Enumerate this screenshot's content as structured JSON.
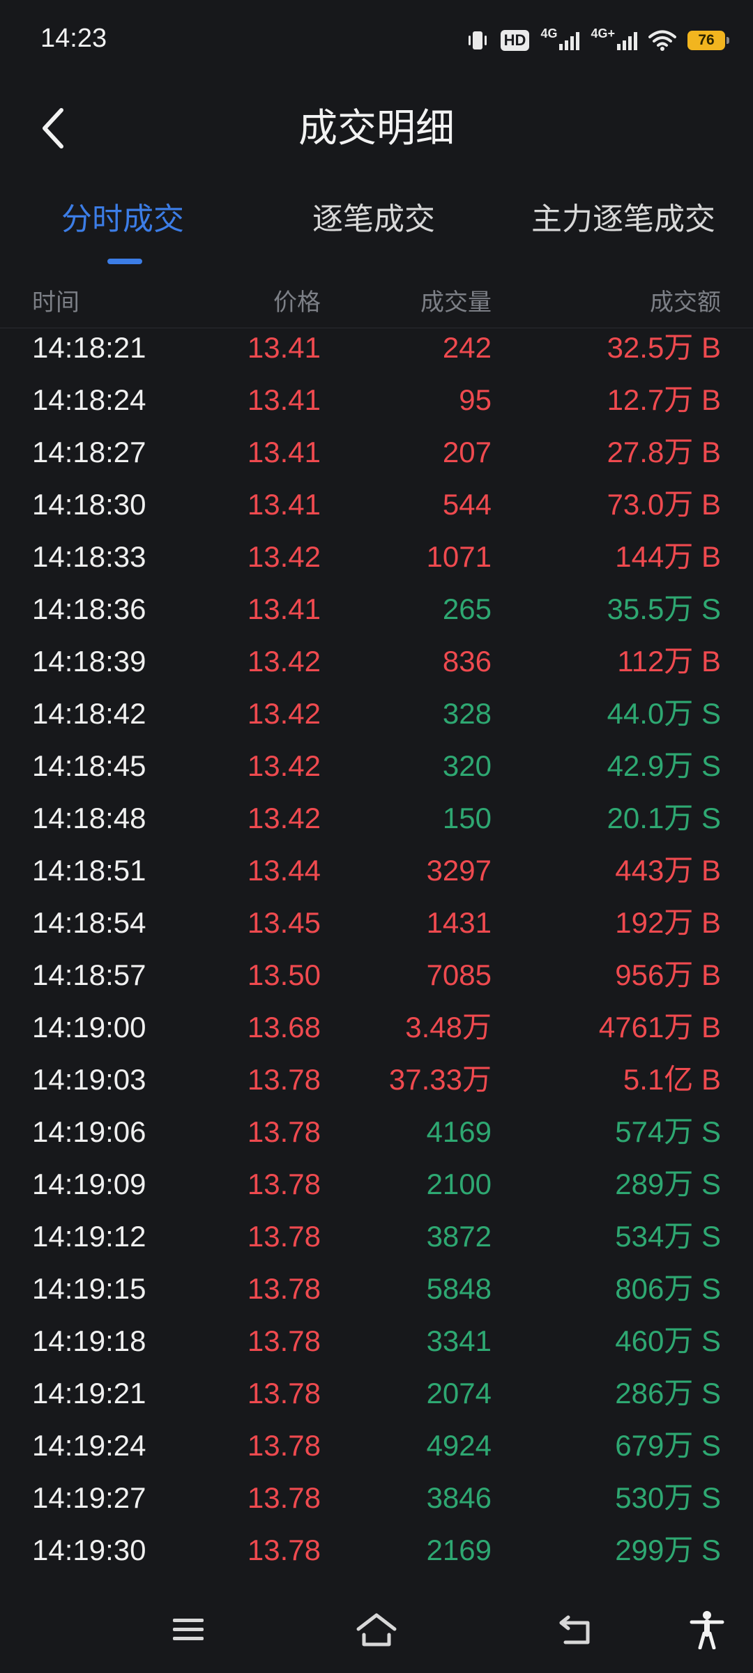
{
  "status_bar": {
    "time": "14:23",
    "hd_label": "HD",
    "net1": "4G",
    "net2": "4G+",
    "battery": "76"
  },
  "header": {
    "title": "成交明细"
  },
  "tabs": [
    {
      "label": "分时成交",
      "active": true
    },
    {
      "label": "逐笔成交",
      "active": false
    },
    {
      "label": "主力逐笔成交",
      "active": false
    }
  ],
  "columns": {
    "time": "时间",
    "price": "价格",
    "volume": "成交量",
    "amount": "成交额"
  },
  "colors": {
    "up": "#ef4a4f",
    "down": "#2ea872",
    "accent": "#3c7de6",
    "background": "#17181b"
  },
  "trades": [
    {
      "time": "14:18:21",
      "price": "13.41",
      "volume": "242",
      "amount": "32.5万 B",
      "side": "B"
    },
    {
      "time": "14:18:24",
      "price": "13.41",
      "volume": "95",
      "amount": "12.7万 B",
      "side": "B"
    },
    {
      "time": "14:18:27",
      "price": "13.41",
      "volume": "207",
      "amount": "27.8万 B",
      "side": "B"
    },
    {
      "time": "14:18:30",
      "price": "13.41",
      "volume": "544",
      "amount": "73.0万 B",
      "side": "B"
    },
    {
      "time": "14:18:33",
      "price": "13.42",
      "volume": "1071",
      "amount": "144万 B",
      "side": "B"
    },
    {
      "time": "14:18:36",
      "price": "13.41",
      "volume": "265",
      "amount": "35.5万 S",
      "side": "S"
    },
    {
      "time": "14:18:39",
      "price": "13.42",
      "volume": "836",
      "amount": "112万 B",
      "side": "B"
    },
    {
      "time": "14:18:42",
      "price": "13.42",
      "volume": "328",
      "amount": "44.0万 S",
      "side": "S"
    },
    {
      "time": "14:18:45",
      "price": "13.42",
      "volume": "320",
      "amount": "42.9万 S",
      "side": "S"
    },
    {
      "time": "14:18:48",
      "price": "13.42",
      "volume": "150",
      "amount": "20.1万 S",
      "side": "S"
    },
    {
      "time": "14:18:51",
      "price": "13.44",
      "volume": "3297",
      "amount": "443万 B",
      "side": "B"
    },
    {
      "time": "14:18:54",
      "price": "13.45",
      "volume": "1431",
      "amount": "192万 B",
      "side": "B"
    },
    {
      "time": "14:18:57",
      "price": "13.50",
      "volume": "7085",
      "amount": "956万 B",
      "side": "B"
    },
    {
      "time": "14:19:00",
      "price": "13.68",
      "volume": "3.48万",
      "amount": "4761万 B",
      "side": "B"
    },
    {
      "time": "14:19:03",
      "price": "13.78",
      "volume": "37.33万",
      "amount": "5.1亿 B",
      "side": "B"
    },
    {
      "time": "14:19:06",
      "price": "13.78",
      "volume": "4169",
      "amount": "574万 S",
      "side": "S"
    },
    {
      "time": "14:19:09",
      "price": "13.78",
      "volume": "2100",
      "amount": "289万 S",
      "side": "S"
    },
    {
      "time": "14:19:12",
      "price": "13.78",
      "volume": "3872",
      "amount": "534万 S",
      "side": "S"
    },
    {
      "time": "14:19:15",
      "price": "13.78",
      "volume": "5848",
      "amount": "806万 S",
      "side": "S"
    },
    {
      "time": "14:19:18",
      "price": "13.78",
      "volume": "3341",
      "amount": "460万 S",
      "side": "S"
    },
    {
      "time": "14:19:21",
      "price": "13.78",
      "volume": "2074",
      "amount": "286万 S",
      "side": "S"
    },
    {
      "time": "14:19:24",
      "price": "13.78",
      "volume": "4924",
      "amount": "679万 S",
      "side": "S"
    },
    {
      "time": "14:19:27",
      "price": "13.78",
      "volume": "3846",
      "amount": "530万 S",
      "side": "S"
    },
    {
      "time": "14:19:30",
      "price": "13.78",
      "volume": "2169",
      "amount": "299万 S",
      "side": "S"
    }
  ],
  "bottom_nav": [
    {
      "icon": "menu-icon"
    },
    {
      "icon": "home-icon"
    },
    {
      "icon": "back-icon"
    },
    {
      "icon": "accessibility-icon"
    }
  ]
}
